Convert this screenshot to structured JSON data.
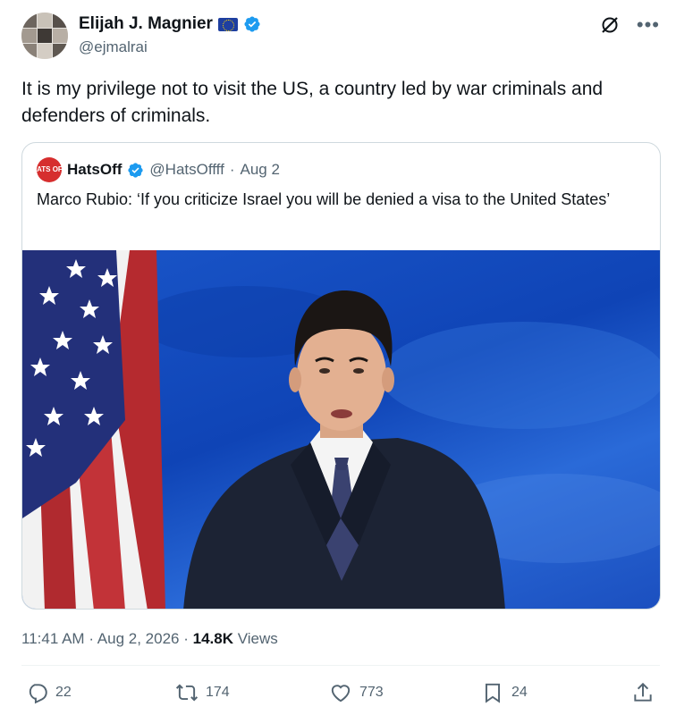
{
  "author": {
    "display_name": "Elijah J. Magnier",
    "handle": "@ejmalrai",
    "avatar_icon": "profile-collage-avatar",
    "flag_icon": "eu-flag-icon",
    "verified_icon": "verified-badge-icon"
  },
  "tweet": {
    "text": "It is my privilege not to visit the US, a country led by war criminals and defenders of criminals."
  },
  "quote": {
    "avatar_text": "HATS OFF",
    "display_name": "HatsOff",
    "handle": "@HatsOffff",
    "separator": "·",
    "date": "Aug 2",
    "text": "Marco Rubio: ‘If you criticize Israel you will be denied a visa to the United States’",
    "media_icon": "video-thumbnail-image"
  },
  "meta": {
    "time": "11:41 AM",
    "separator": "·",
    "date": "Aug 2, 2026",
    "separator2": "·",
    "views_count": "14.8K",
    "views_label": "Views"
  },
  "actions": {
    "replies": "22",
    "reposts": "174",
    "likes": "773",
    "bookmarks": "24"
  },
  "colors": {
    "verified_blue": "#1d9bf0",
    "secondary_text": "#536471",
    "primary_text": "#0f1419",
    "border": "#cfd9de"
  }
}
